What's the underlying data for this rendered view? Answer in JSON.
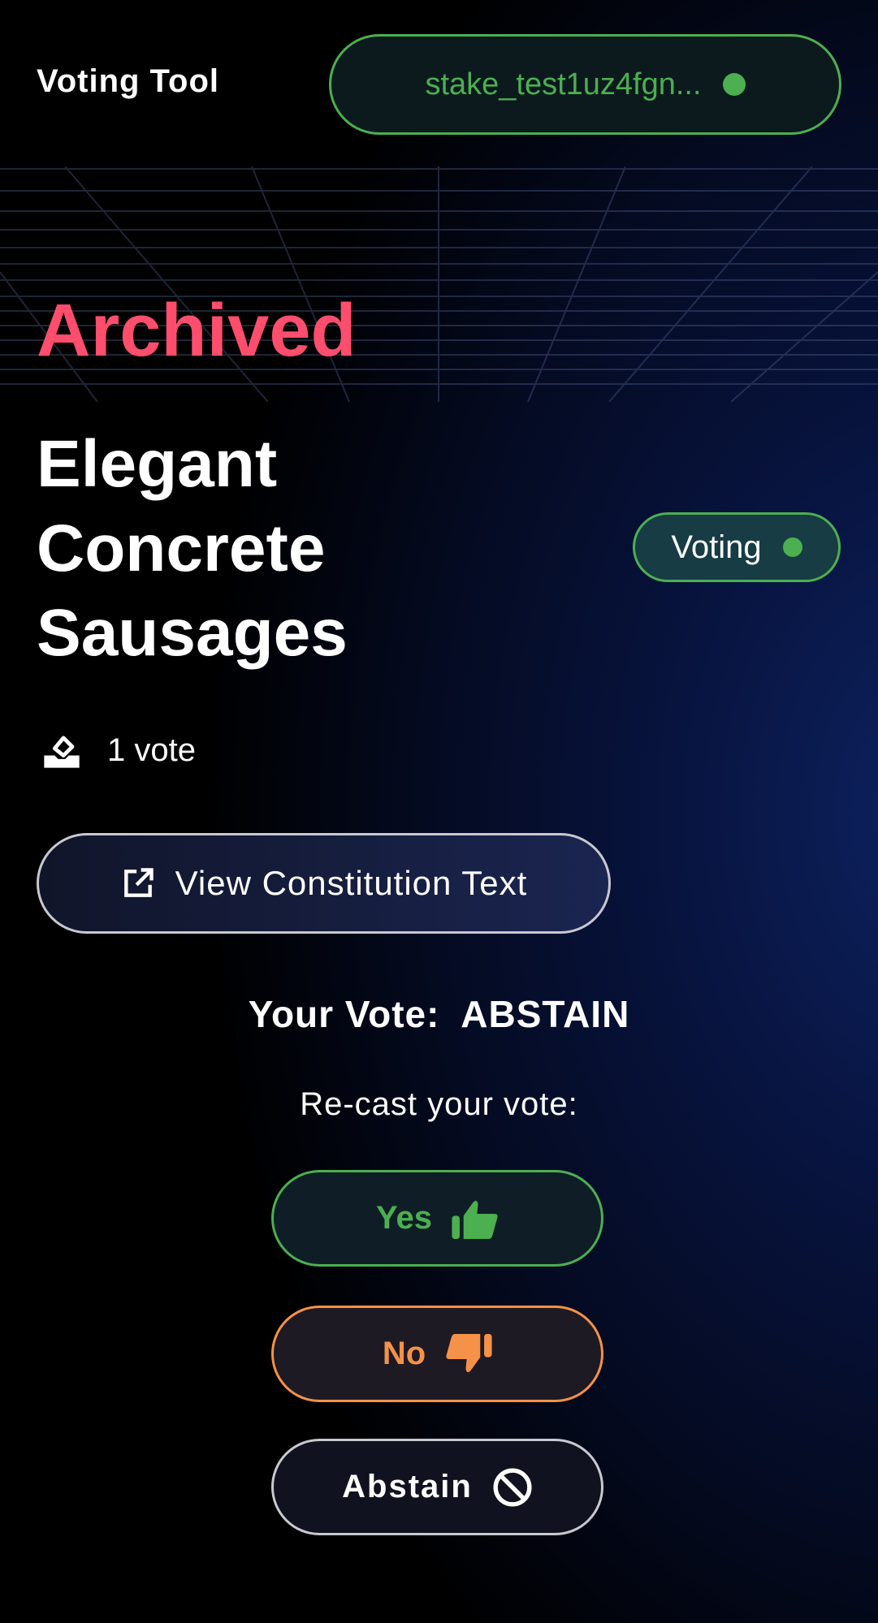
{
  "header": {
    "brand": "Voting Tool",
    "wallet_address": "stake_test1uz4fgn...",
    "wallet_status_color": "#4caf50"
  },
  "proposal": {
    "status_label": "Archived",
    "title": "Elegant Concrete Sausages",
    "phase_badge": "Voting",
    "vote_count": "1 vote"
  },
  "actions": {
    "view_constitution": "View Constitution Text"
  },
  "vote": {
    "your_vote_label": "Your Vote:",
    "your_vote_value": "ABSTAIN",
    "recast_label": "Re-cast your vote:",
    "yes": "Yes",
    "no": "No",
    "abstain": "Abstain"
  },
  "colors": {
    "yes": "#4caf50",
    "no": "#f59148",
    "archived": "#ff4d6d"
  }
}
